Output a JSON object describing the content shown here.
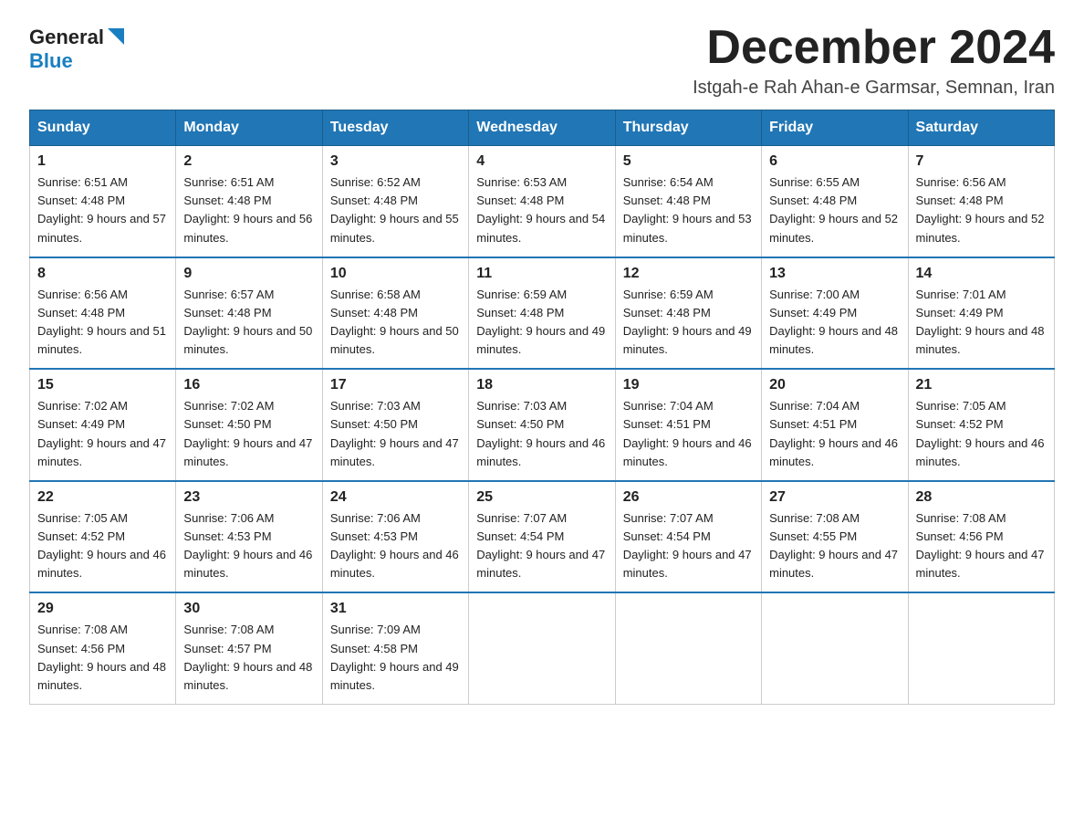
{
  "logo": {
    "general": "General",
    "blue": "Blue"
  },
  "header": {
    "month": "December 2024",
    "subtitle": "Istgah-e Rah Ahan-e Garmsar, Semnan, Iran"
  },
  "weekdays": [
    "Sunday",
    "Monday",
    "Tuesday",
    "Wednesday",
    "Thursday",
    "Friday",
    "Saturday"
  ],
  "weeks": [
    [
      {
        "day": "1",
        "sunrise": "Sunrise: 6:51 AM",
        "sunset": "Sunset: 4:48 PM",
        "daylight": "Daylight: 9 hours and 57 minutes."
      },
      {
        "day": "2",
        "sunrise": "Sunrise: 6:51 AM",
        "sunset": "Sunset: 4:48 PM",
        "daylight": "Daylight: 9 hours and 56 minutes."
      },
      {
        "day": "3",
        "sunrise": "Sunrise: 6:52 AM",
        "sunset": "Sunset: 4:48 PM",
        "daylight": "Daylight: 9 hours and 55 minutes."
      },
      {
        "day": "4",
        "sunrise": "Sunrise: 6:53 AM",
        "sunset": "Sunset: 4:48 PM",
        "daylight": "Daylight: 9 hours and 54 minutes."
      },
      {
        "day": "5",
        "sunrise": "Sunrise: 6:54 AM",
        "sunset": "Sunset: 4:48 PM",
        "daylight": "Daylight: 9 hours and 53 minutes."
      },
      {
        "day": "6",
        "sunrise": "Sunrise: 6:55 AM",
        "sunset": "Sunset: 4:48 PM",
        "daylight": "Daylight: 9 hours and 52 minutes."
      },
      {
        "day": "7",
        "sunrise": "Sunrise: 6:56 AM",
        "sunset": "Sunset: 4:48 PM",
        "daylight": "Daylight: 9 hours and 52 minutes."
      }
    ],
    [
      {
        "day": "8",
        "sunrise": "Sunrise: 6:56 AM",
        "sunset": "Sunset: 4:48 PM",
        "daylight": "Daylight: 9 hours and 51 minutes."
      },
      {
        "day": "9",
        "sunrise": "Sunrise: 6:57 AM",
        "sunset": "Sunset: 4:48 PM",
        "daylight": "Daylight: 9 hours and 50 minutes."
      },
      {
        "day": "10",
        "sunrise": "Sunrise: 6:58 AM",
        "sunset": "Sunset: 4:48 PM",
        "daylight": "Daylight: 9 hours and 50 minutes."
      },
      {
        "day": "11",
        "sunrise": "Sunrise: 6:59 AM",
        "sunset": "Sunset: 4:48 PM",
        "daylight": "Daylight: 9 hours and 49 minutes."
      },
      {
        "day": "12",
        "sunrise": "Sunrise: 6:59 AM",
        "sunset": "Sunset: 4:48 PM",
        "daylight": "Daylight: 9 hours and 49 minutes."
      },
      {
        "day": "13",
        "sunrise": "Sunrise: 7:00 AM",
        "sunset": "Sunset: 4:49 PM",
        "daylight": "Daylight: 9 hours and 48 minutes."
      },
      {
        "day": "14",
        "sunrise": "Sunrise: 7:01 AM",
        "sunset": "Sunset: 4:49 PM",
        "daylight": "Daylight: 9 hours and 48 minutes."
      }
    ],
    [
      {
        "day": "15",
        "sunrise": "Sunrise: 7:02 AM",
        "sunset": "Sunset: 4:49 PM",
        "daylight": "Daylight: 9 hours and 47 minutes."
      },
      {
        "day": "16",
        "sunrise": "Sunrise: 7:02 AM",
        "sunset": "Sunset: 4:50 PM",
        "daylight": "Daylight: 9 hours and 47 minutes."
      },
      {
        "day": "17",
        "sunrise": "Sunrise: 7:03 AM",
        "sunset": "Sunset: 4:50 PM",
        "daylight": "Daylight: 9 hours and 47 minutes."
      },
      {
        "day": "18",
        "sunrise": "Sunrise: 7:03 AM",
        "sunset": "Sunset: 4:50 PM",
        "daylight": "Daylight: 9 hours and 46 minutes."
      },
      {
        "day": "19",
        "sunrise": "Sunrise: 7:04 AM",
        "sunset": "Sunset: 4:51 PM",
        "daylight": "Daylight: 9 hours and 46 minutes."
      },
      {
        "day": "20",
        "sunrise": "Sunrise: 7:04 AM",
        "sunset": "Sunset: 4:51 PM",
        "daylight": "Daylight: 9 hours and 46 minutes."
      },
      {
        "day": "21",
        "sunrise": "Sunrise: 7:05 AM",
        "sunset": "Sunset: 4:52 PM",
        "daylight": "Daylight: 9 hours and 46 minutes."
      }
    ],
    [
      {
        "day": "22",
        "sunrise": "Sunrise: 7:05 AM",
        "sunset": "Sunset: 4:52 PM",
        "daylight": "Daylight: 9 hours and 46 minutes."
      },
      {
        "day": "23",
        "sunrise": "Sunrise: 7:06 AM",
        "sunset": "Sunset: 4:53 PM",
        "daylight": "Daylight: 9 hours and 46 minutes."
      },
      {
        "day": "24",
        "sunrise": "Sunrise: 7:06 AM",
        "sunset": "Sunset: 4:53 PM",
        "daylight": "Daylight: 9 hours and 46 minutes."
      },
      {
        "day": "25",
        "sunrise": "Sunrise: 7:07 AM",
        "sunset": "Sunset: 4:54 PM",
        "daylight": "Daylight: 9 hours and 47 minutes."
      },
      {
        "day": "26",
        "sunrise": "Sunrise: 7:07 AM",
        "sunset": "Sunset: 4:54 PM",
        "daylight": "Daylight: 9 hours and 47 minutes."
      },
      {
        "day": "27",
        "sunrise": "Sunrise: 7:08 AM",
        "sunset": "Sunset: 4:55 PM",
        "daylight": "Daylight: 9 hours and 47 minutes."
      },
      {
        "day": "28",
        "sunrise": "Sunrise: 7:08 AM",
        "sunset": "Sunset: 4:56 PM",
        "daylight": "Daylight: 9 hours and 47 minutes."
      }
    ],
    [
      {
        "day": "29",
        "sunrise": "Sunrise: 7:08 AM",
        "sunset": "Sunset: 4:56 PM",
        "daylight": "Daylight: 9 hours and 48 minutes."
      },
      {
        "day": "30",
        "sunrise": "Sunrise: 7:08 AM",
        "sunset": "Sunset: 4:57 PM",
        "daylight": "Daylight: 9 hours and 48 minutes."
      },
      {
        "day": "31",
        "sunrise": "Sunrise: 7:09 AM",
        "sunset": "Sunset: 4:58 PM",
        "daylight": "Daylight: 9 hours and 49 minutes."
      },
      null,
      null,
      null,
      null
    ]
  ]
}
